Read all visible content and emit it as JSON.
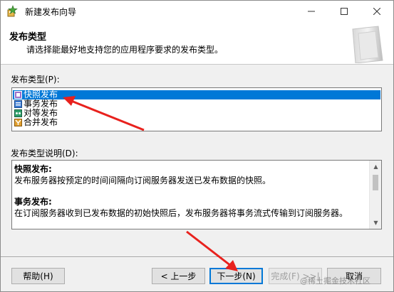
{
  "window": {
    "title": "新建发布向导"
  },
  "header": {
    "title": "发布类型",
    "subtitle": "请选择能最好地支持您的应用程序要求的发布类型。"
  },
  "publication_type": {
    "label": "发布类型(P):",
    "items": [
      {
        "label": "快照发布",
        "selected": true
      },
      {
        "label": "事务发布",
        "selected": false
      },
      {
        "label": "对等发布",
        "selected": false
      },
      {
        "label": "合并发布",
        "selected": false
      }
    ]
  },
  "description": {
    "label": "发布类型说明(D):",
    "sections": [
      {
        "heading": "快照发布:",
        "text": "发布服务器按预定的时间间隔向订阅服务器发送已发布数据的快照。"
      },
      {
        "heading": "事务发布:",
        "text": "在订阅服务器收到已发布数据的初始快照后，发布服务器将事务流式传输到订阅服务器。"
      }
    ]
  },
  "buttons": {
    "help": "帮助(H)",
    "back": "< 上一步",
    "next": "下一步(N)",
    "finish": "完成(F) >>|",
    "cancel": "取消"
  },
  "watermark": "@稀土掘金技术社区",
  "colors": {
    "selection": "#0078d7",
    "arrow": "#e8211d"
  }
}
